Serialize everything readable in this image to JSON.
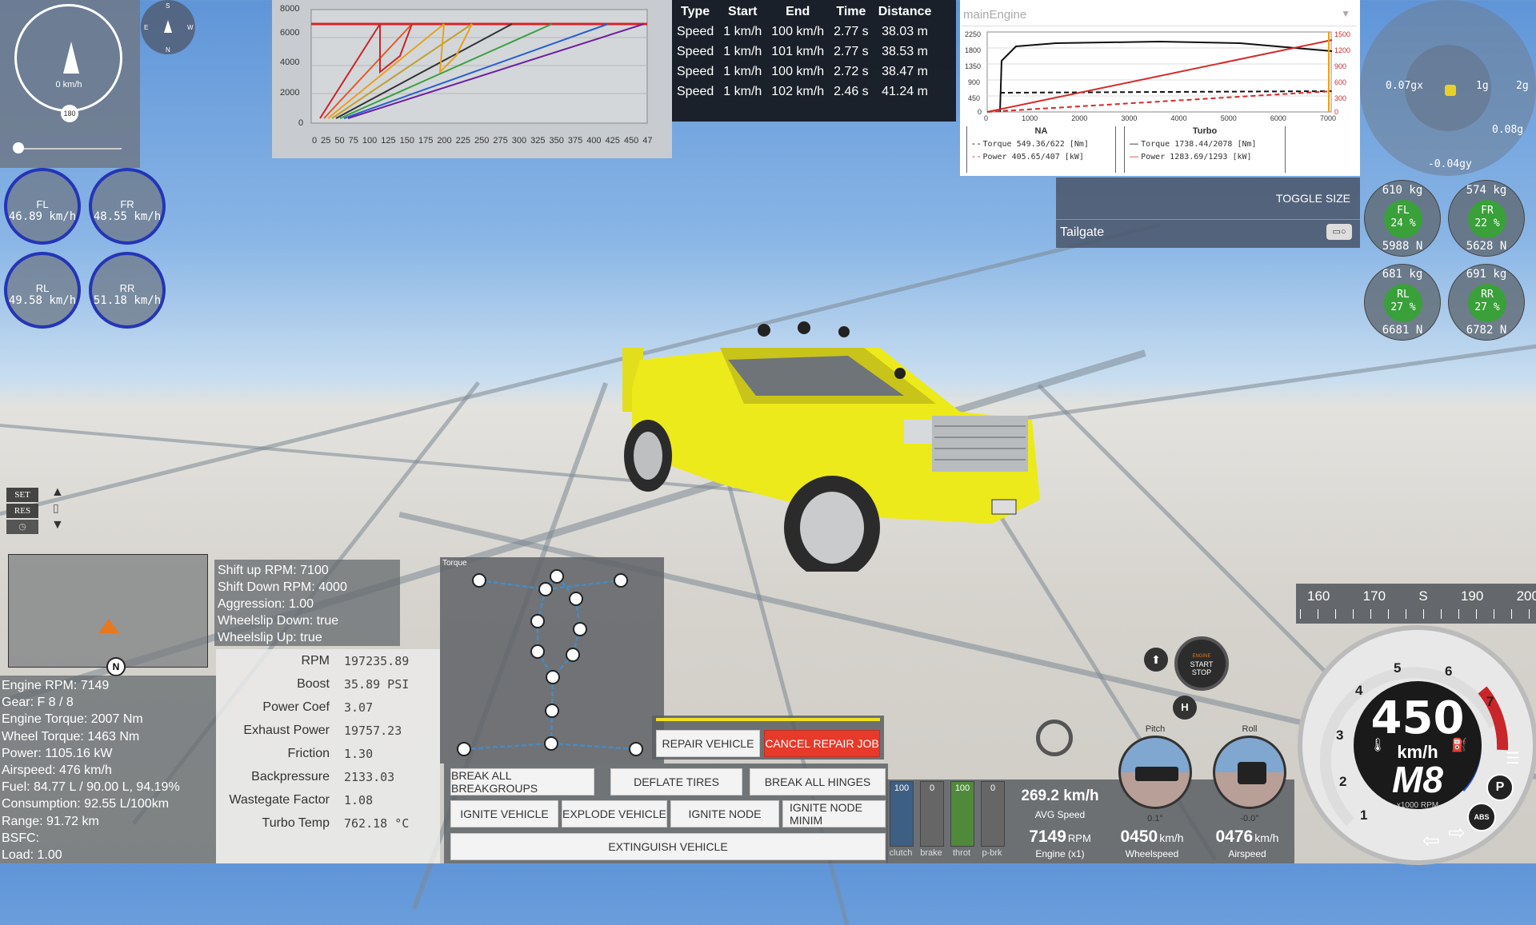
{
  "speedo_small": {
    "speed": "0 km/h",
    "max_mark": "180"
  },
  "compass": {
    "north": "N",
    "south": "S",
    "east": "E",
    "west": "W"
  },
  "wheel_speeds": [
    {
      "name": "FL",
      "speed": "46.89 km/h"
    },
    {
      "name": "FR",
      "speed": "48.55 km/h"
    },
    {
      "name": "RL",
      "speed": "49.58 km/h"
    },
    {
      "name": "RR",
      "speed": "51.18 km/h"
    }
  ],
  "accel_graph": {
    "y_ticks": [
      "8000",
      "6000",
      "4000",
      "2000",
      "0"
    ],
    "x_ticks": [
      "0",
      "25",
      "50",
      "75",
      "100",
      "125",
      "150",
      "175",
      "200",
      "225",
      "250",
      "275",
      "300",
      "325",
      "350",
      "375",
      "400",
      "425",
      "450",
      "47"
    ]
  },
  "accel_table": {
    "headers": [
      "Type",
      "Start",
      "End",
      "Time",
      "Distance"
    ],
    "rows": [
      [
        "Speed",
        "1 km/h",
        "100 km/h",
        "2.77 s",
        "38.03 m"
      ],
      [
        "Speed",
        "1 km/h",
        "101 km/h",
        "2.77 s",
        "38.53 m"
      ],
      [
        "Speed",
        "1 km/h",
        "100 km/h",
        "2.72 s",
        "38.47 m"
      ],
      [
        "Speed",
        "1 km/h",
        "102 km/h",
        "2.46 s",
        "41.24 m"
      ]
    ]
  },
  "engine_graph": {
    "title": "mainEngine",
    "y_left": [
      "2250",
      "1800",
      "1350",
      "900",
      "450",
      "0"
    ],
    "y_right": [
      "1500",
      "1200",
      "900",
      "600",
      "300",
      "0"
    ],
    "x_ticks": [
      "0",
      "1000",
      "2000",
      "3000",
      "4000",
      "5000",
      "6000",
      "7000"
    ],
    "legend_na": {
      "title": "NA",
      "torque": "Torque 549.36/622 [Nm]",
      "power": "Power 405.65/407 [kW]"
    },
    "legend_turbo": {
      "title": "Turbo",
      "torque": "Torque 1738.44/2078 [Nm]",
      "power": "Power 1283.69/1293 [kW]"
    }
  },
  "gforce": {
    "left": "0.07gx",
    "one_g": "1g",
    "two_g": "2g",
    "right": "0.08g",
    "bottom": "-0.04gy"
  },
  "toggle_panel": {
    "toggle_label": "TOGGLE SIZE",
    "item": "Tailgate"
  },
  "wheel_loads": [
    {
      "name": "FL",
      "kg": "610 kg",
      "pct": "24 %",
      "n": "5988 N"
    },
    {
      "name": "FR",
      "kg": "574 kg",
      "pct": "22 %",
      "n": "5628 N"
    },
    {
      "name": "RL",
      "kg": "681 kg",
      "pct": "27 %",
      "n": "6681 N"
    },
    {
      "name": "RR",
      "kg": "691 kg",
      "pct": "27 %",
      "n": "6782 N"
    }
  ],
  "cruise": {
    "set": "SET",
    "res": "RES"
  },
  "minimap": {
    "north": "N"
  },
  "shift_info": [
    "Shift up RPM: 7100",
    "Shift Down RPM: 4000",
    "Aggression: 1.00",
    "Wheelslip Down: true",
    "Wheelslip Up: true"
  ],
  "engine_info": [
    "Engine RPM: 7149",
    "Gear: F 8 / 8",
    "Engine Torque: 2007 Nm",
    "Wheel Torque: 1463 Nm",
    "Power: 1105.16 kW",
    "Airspeed: 476 km/h",
    "Fuel: 84.77 L / 90.00 L, 94.19%",
    "Consumption: 92.55 L/100km",
    "Range: 91.72 km",
    "BSFC:",
    "Load: 1.00"
  ],
  "turbo_stats": [
    {
      "k": "RPM",
      "v": "197235.89"
    },
    {
      "k": "Boost",
      "v": "35.89 PSI"
    },
    {
      "k": "Power Coef",
      "v": "3.07"
    },
    {
      "k": "Exhaust Power",
      "v": "19757.23"
    },
    {
      "k": "Friction",
      "v": "1.30"
    },
    {
      "k": "Backpressure",
      "v": "2133.03"
    },
    {
      "k": "Wastegate Factor",
      "v": "1.08"
    },
    {
      "k": "Turbo Temp",
      "v": "762.18 °C"
    }
  ],
  "torque_tree": {
    "title": "Torque"
  },
  "repair": {
    "repair": "REPAIR VEHICLE",
    "cancel": "CANCEL REPAIR JOB"
  },
  "actions": {
    "break_breakgroups": "BREAK ALL BREAKGROUPS",
    "deflate": "DEFLATE TIRES",
    "break_hinges": "BREAK ALL HINGES",
    "ignite_vehicle": "IGNITE VEHICLE",
    "explode": "EXPLODE VEHICLE",
    "ignite_node": "IGNITE NODE",
    "ignite_node_min": "IGNITE NODE MINIM",
    "extinguish": "EXTINGUISH VEHICLE"
  },
  "pedals": [
    {
      "name": "clutch",
      "value": "100",
      "fill": 1.0,
      "color": "#3e5f84"
    },
    {
      "name": "brake",
      "value": "0",
      "fill": 0.0,
      "color": "#777777"
    },
    {
      "name": "throt",
      "value": "100",
      "fill": 1.0,
      "color": "#4f8a3a"
    },
    {
      "name": "p-brk",
      "value": "0",
      "fill": 0.0,
      "color": "#777777"
    }
  ],
  "readouts": {
    "avg_speed": "269.2 km/h",
    "avg_label": "AVG Speed",
    "rpm": "7149",
    "rpm_unit": "RPM",
    "rpm_label": "Engine (x1)",
    "wheelspeed": "0450",
    "wheelspeed_unit": "km/h",
    "wheelspeed_label": "Wheelspeed",
    "airspeed": "0476",
    "airspeed_unit": "km/h",
    "airspeed_label": "Airspeed"
  },
  "attitude": {
    "pitch": "Pitch",
    "pitch_val": "0.1°",
    "roll": "Roll",
    "roll_val": "-0.0°"
  },
  "engine_button": {
    "line1": "ENGINE",
    "line2": "START",
    "line3": "STOP"
  },
  "heading_tape": [
    "160",
    "170",
    "S",
    "190",
    "200"
  ],
  "main_gauge": {
    "speed": "450",
    "unit": "km/h",
    "gear": "M8",
    "rpm_label": "x1000 RPM",
    "ticks": [
      "1",
      "2",
      "3",
      "4",
      "5",
      "6",
      "7"
    ],
    "abs": "ABS",
    "park": "P"
  }
}
